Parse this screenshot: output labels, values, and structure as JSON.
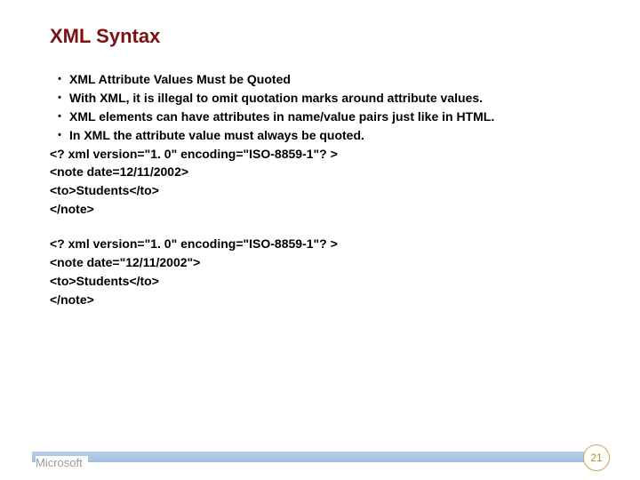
{
  "title": "XML Syntax",
  "bullets": {
    "b1": "XML Attribute Values Must be Quoted",
    "b2": "With XML, it is illegal to omit quotation marks around attribute values.",
    "b3": "XML elements can have attributes in name/value pairs just like in HTML.",
    "b4": "In XML the attribute value must always be quoted."
  },
  "example1": {
    "l1": "<? xml version=\"1. 0\" encoding=\"ISO-8859-1\"? >",
    "l2": "<note date=12/11/2002>",
    "l3": "<to>Students</to>",
    "l4": "</note>"
  },
  "example2": {
    "l1": "<? xml version=\"1. 0\" encoding=\"ISO-8859-1\"? >",
    "l2": "<note date=\"12/11/2002\">",
    "l3": "<to>Students</to>",
    "l4": "</note>"
  },
  "footer": {
    "brand": "Microsoft",
    "page": "21"
  }
}
